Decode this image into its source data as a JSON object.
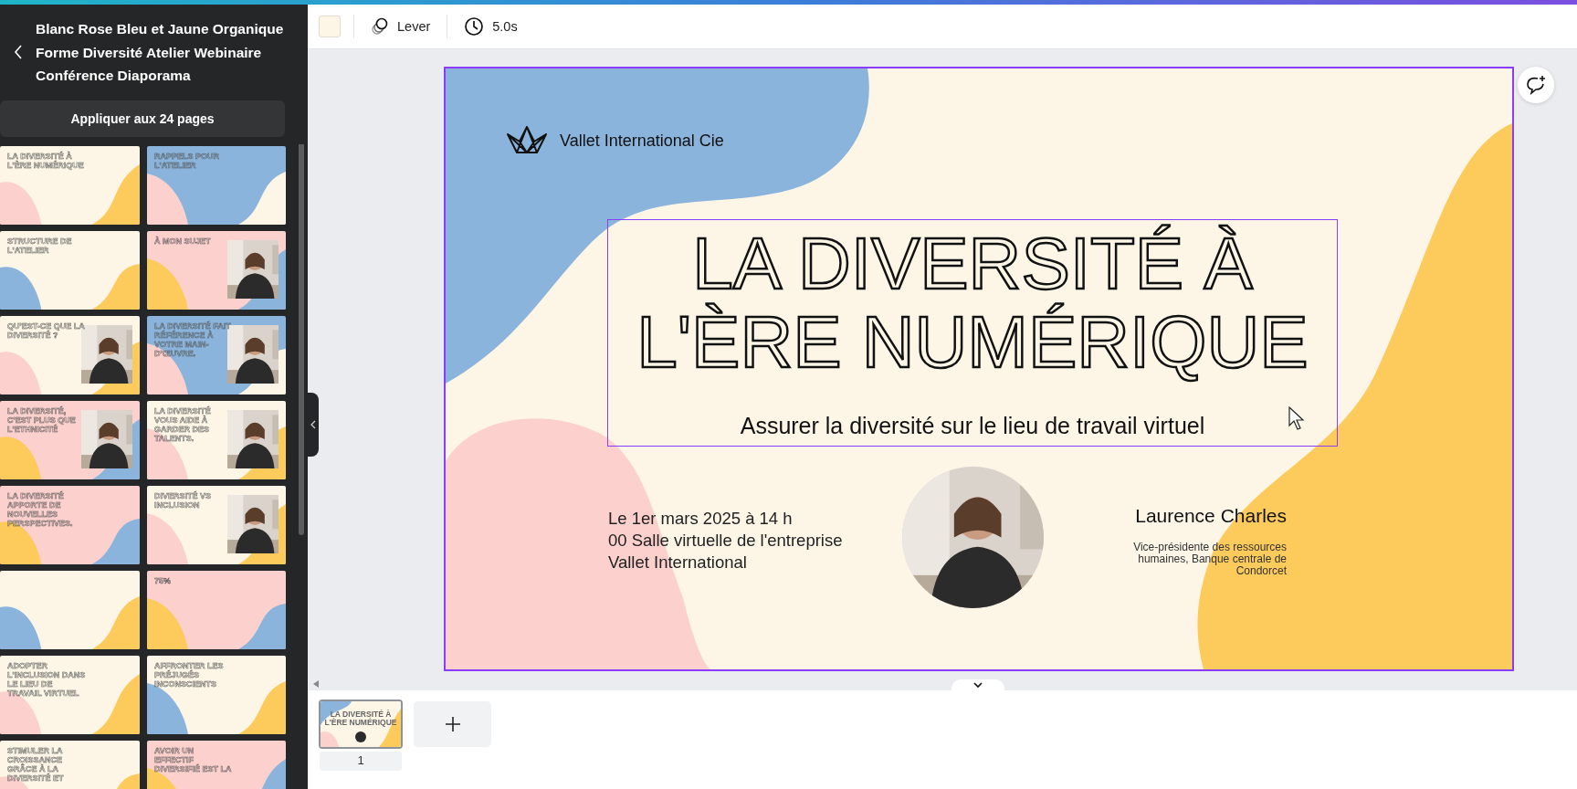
{
  "sidebar": {
    "template_title": "Blanc Rose Bleu et Jaune Organique Forme Diversité Atelier Webinaire Conférence Diaporama",
    "apply_button": "Appliquer aux 24 pages",
    "thumbnails": [
      {
        "title": "LA DIVERSITÉ À L'ÈRE NUMÉRIQUE",
        "kind": "cream",
        "photo": false,
        "selected": false
      },
      {
        "title": "RAPPELS POUR L'ATELIER",
        "kind": "blue",
        "photo": false,
        "selected": false
      },
      {
        "title": "STRUCTURE DE L'ATELIER",
        "kind": "yellow",
        "photo": false,
        "selected": false
      },
      {
        "title": "À MON SUJET",
        "kind": "pink",
        "photo": true,
        "selected": false
      },
      {
        "title": "QU'EST-CE QUE LA DIVERSITÉ ?",
        "kind": "cream",
        "photo": true,
        "selected": false
      },
      {
        "title": "LA DIVERSITÉ FAIT RÉFÉRENCE À VOTRE MAIN-D'ŒUVRE.",
        "kind": "blue",
        "photo": true,
        "selected": false
      },
      {
        "title": "LA DIVERSITÉ, C'EST PLUS QUE L'ETHNICITÉ",
        "kind": "pink",
        "photo": true,
        "selected": false
      },
      {
        "title": "LA DIVERSITÉ VOUS AIDE À GARDER DES TALENTS.",
        "kind": "cream",
        "photo": true,
        "selected": false
      },
      {
        "title": "LA DIVERSITÉ APPORTE DE NOUVELLES PERSPECTIVES.",
        "kind": "pink",
        "photo": false,
        "selected": false
      },
      {
        "title": "DIVERSITÉ VS INCLUSION",
        "kind": "cream",
        "photo": true,
        "selected": false
      },
      {
        "kind": "yellow",
        "photo": false,
        "selected": false
      },
      {
        "title": "75%",
        "kind": "pink",
        "photo": false,
        "selected": false
      },
      {
        "title": "ADOPTER L'INCLUSION DANS LE LIEU DE TRAVAIL VIRTUEL",
        "kind": "cream",
        "photo": false,
        "selected": false
      },
      {
        "title": "AFFRONTER LES PRÉJUGÉS INCONSCIENTS",
        "kind": "yellow",
        "photo": false,
        "selected": false
      },
      {
        "title": "STIMULER LA CROISSANCE GRÂCE À LA DIVERSITÉ ET",
        "kind": "cream",
        "photo": false,
        "selected": false
      },
      {
        "title": "AVOIR UN EFFECTIF DIVERSIFIÉ EST LA",
        "kind": "pink",
        "photo": false,
        "selected": false
      }
    ]
  },
  "toolbar": {
    "animation": "Lever",
    "duration": "5.0s"
  },
  "slide": {
    "company": "Vallet International Cie",
    "title_lines": [
      "LA DIVERSITÉ À",
      "L'ÈRE NUMÉRIQUE"
    ],
    "subtitle": "Assurer la diversité sur le lieu de travail virtuel",
    "event_lines": [
      "Le 1er mars 2025 à 14 h",
      "00 Salle virtuelle de l'entreprise",
      "Vallet International"
    ],
    "speaker": "Laurence Charles",
    "speaker_role": "Vice-présidente des ressources humaines, Banque centrale de Condorcet"
  },
  "pages": [
    {
      "number": "1",
      "title": "LA DIVERSITÉ À L'ÈRE NUMÉRIQUE",
      "selected": true
    }
  ]
}
